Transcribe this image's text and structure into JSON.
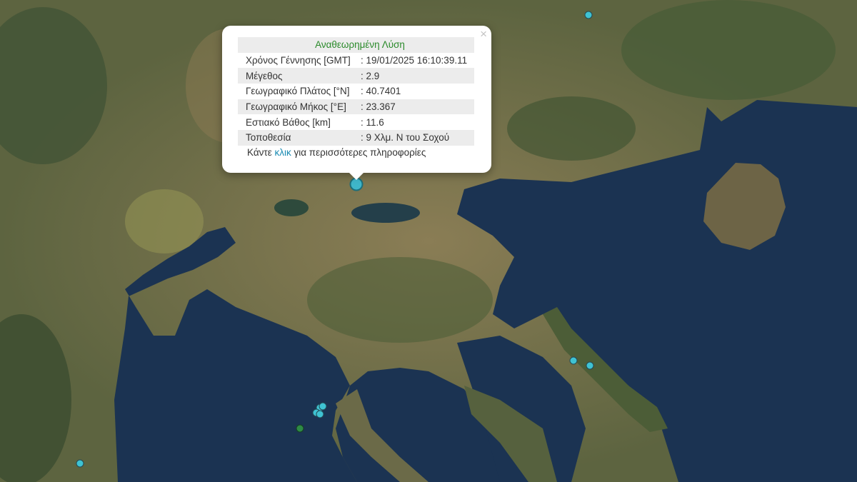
{
  "popup": {
    "title": "Αναθεωρημένη Λύση",
    "rows": [
      {
        "label": "Χρόνος Γέννησης [GMT]",
        "value": ": 19/01/2025 16:10:39.11"
      },
      {
        "label": "Μέγεθος",
        "value": ": 2.9"
      },
      {
        "label": "Γεωγραφικό Πλάτος [°N]",
        "value": ": 40.7401"
      },
      {
        "label": "Γεωγραφικό Μήκος [°E]",
        "value": ": 23.367"
      },
      {
        "label": "Εστιακό Βάθος [km]",
        "value": ": 11.6"
      },
      {
        "label": "Τοποθεσία",
        "value": ": 9 Χλμ. Ν του Σοχού"
      }
    ],
    "more_prefix": "Κάντε ",
    "more_link": "κλικ",
    "more_suffix": " για περισσότερες πληροφορίες",
    "close_glyph": "×"
  },
  "colors": {
    "sea": "#1b3352",
    "land": "#6b6a48",
    "marker": "#3fc3d3",
    "marker_alt": "#2e8b46"
  }
}
